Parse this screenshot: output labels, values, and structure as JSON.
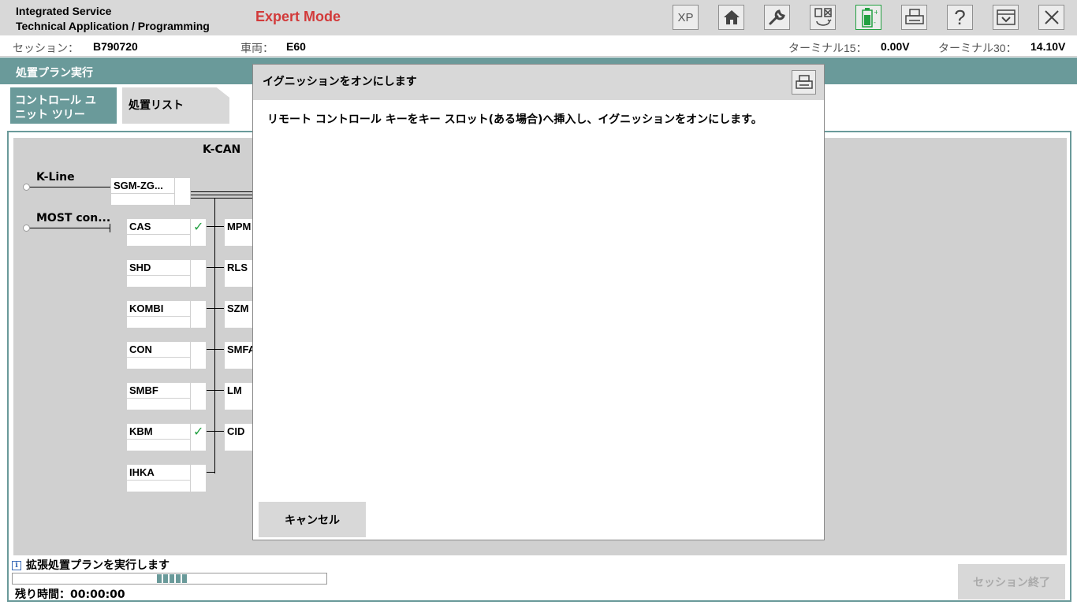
{
  "header": {
    "app_title_line1": "Integrated Service",
    "app_title_line2": "Technical Application / Programming",
    "mode": "Expert Mode",
    "toolbar": [
      {
        "name": "xp-button",
        "icon": "text-xp",
        "label": "XP"
      },
      {
        "name": "home-button",
        "icon": "home-icon"
      },
      {
        "name": "settings-button",
        "icon": "wrench-icon"
      },
      {
        "name": "switch-button",
        "icon": "switch-icon"
      },
      {
        "name": "battery-button",
        "icon": "battery-icon"
      },
      {
        "name": "print-button",
        "icon": "printer-icon"
      },
      {
        "name": "help-button",
        "icon": "help-icon",
        "label": "?"
      },
      {
        "name": "collapse-button",
        "icon": "collapse-icon"
      },
      {
        "name": "close-button",
        "icon": "close-icon"
      }
    ]
  },
  "infobar": {
    "session_label": "セッション：",
    "session_value": "B790720",
    "vehicle_label": "車両：",
    "vehicle_value": "E60",
    "terminal15_label": "ターミナル15：",
    "terminal15_value": "0.00V",
    "terminal30_label": "ターミナル30：",
    "terminal30_value": "14.10V"
  },
  "section_title": "処置プラン実行",
  "tabs": [
    {
      "label_line1": "コントロール ユ",
      "label_line2": "ニット ツリー",
      "active": true
    },
    {
      "label": "処置リスト",
      "active": false
    }
  ],
  "tree": {
    "bus_title": "K-CAN",
    "kline_label": "K-Line",
    "most_label": "MOST con...",
    "gateway": "SGM-ZG...",
    "left_units": [
      {
        "name": "CAS",
        "checked": true
      },
      {
        "name": "SHD",
        "checked": false
      },
      {
        "name": "KOMBI",
        "checked": false
      },
      {
        "name": "CON",
        "checked": false
      },
      {
        "name": "SMBF",
        "checked": false
      },
      {
        "name": "KBM",
        "checked": true
      },
      {
        "name": "IHKA",
        "checked": false
      }
    ],
    "right_units": [
      "MPM",
      "RLS",
      "SZM",
      "SMFA",
      "LM",
      "CID"
    ]
  },
  "status": {
    "message": "拡張処置プランを実行します",
    "progress": 0.1,
    "remaining": "残り時間：00:00:00",
    "end_session": "セッション終了"
  },
  "dialog": {
    "title": "イグニッションをオンにします",
    "body": "リモート コントロール キーをキー スロット(ある場合)へ挿入し、イグニッションをオンにします。",
    "cancel": "キャンセル"
  },
  "colors": {
    "teal": "#6a9a9a",
    "mode_red": "#d23a3a",
    "check_green": "#22a041",
    "battery_green": "#22a041"
  }
}
